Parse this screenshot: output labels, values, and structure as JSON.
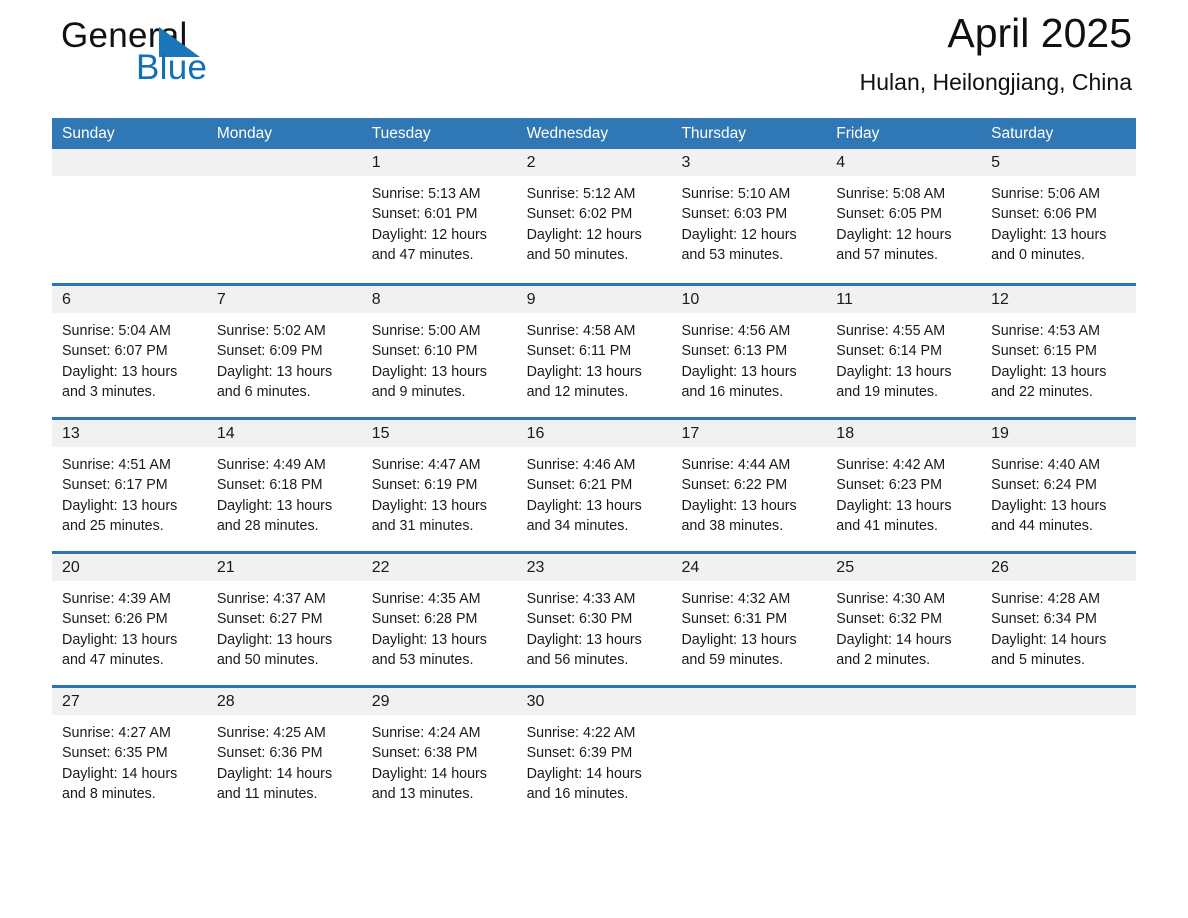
{
  "brand": {
    "word1": "General",
    "word2": "Blue",
    "triangle_color": "#1976b8",
    "blue_text_color": "#1270b8"
  },
  "header": {
    "title": "April 2025",
    "subtitle": "Hulan, Heilongjiang, China"
  },
  "theme": {
    "header_blue": "#3077b5",
    "row_divider_blue": "#2e74b3",
    "day_band_gray": "#f1f1f1"
  },
  "weekdays": [
    "Sunday",
    "Monday",
    "Tuesday",
    "Wednesday",
    "Thursday",
    "Friday",
    "Saturday"
  ],
  "weeks": [
    [
      {
        "day": "",
        "lines": []
      },
      {
        "day": "",
        "lines": []
      },
      {
        "day": "1",
        "lines": [
          "Sunrise: 5:13 AM",
          "Sunset: 6:01 PM",
          "Daylight: 12 hours",
          "and 47 minutes."
        ]
      },
      {
        "day": "2",
        "lines": [
          "Sunrise: 5:12 AM",
          "Sunset: 6:02 PM",
          "Daylight: 12 hours",
          "and 50 minutes."
        ]
      },
      {
        "day": "3",
        "lines": [
          "Sunrise: 5:10 AM",
          "Sunset: 6:03 PM",
          "Daylight: 12 hours",
          "and 53 minutes."
        ]
      },
      {
        "day": "4",
        "lines": [
          "Sunrise: 5:08 AM",
          "Sunset: 6:05 PM",
          "Daylight: 12 hours",
          "and 57 minutes."
        ]
      },
      {
        "day": "5",
        "lines": [
          "Sunrise: 5:06 AM",
          "Sunset: 6:06 PM",
          "Daylight: 13 hours",
          "and 0 minutes."
        ]
      }
    ],
    [
      {
        "day": "6",
        "lines": [
          "Sunrise: 5:04 AM",
          "Sunset: 6:07 PM",
          "Daylight: 13 hours",
          "and 3 minutes."
        ]
      },
      {
        "day": "7",
        "lines": [
          "Sunrise: 5:02 AM",
          "Sunset: 6:09 PM",
          "Daylight: 13 hours",
          "and 6 minutes."
        ]
      },
      {
        "day": "8",
        "lines": [
          "Sunrise: 5:00 AM",
          "Sunset: 6:10 PM",
          "Daylight: 13 hours",
          "and 9 minutes."
        ]
      },
      {
        "day": "9",
        "lines": [
          "Sunrise: 4:58 AM",
          "Sunset: 6:11 PM",
          "Daylight: 13 hours",
          "and 12 minutes."
        ]
      },
      {
        "day": "10",
        "lines": [
          "Sunrise: 4:56 AM",
          "Sunset: 6:13 PM",
          "Daylight: 13 hours",
          "and 16 minutes."
        ]
      },
      {
        "day": "11",
        "lines": [
          "Sunrise: 4:55 AM",
          "Sunset: 6:14 PM",
          "Daylight: 13 hours",
          "and 19 minutes."
        ]
      },
      {
        "day": "12",
        "lines": [
          "Sunrise: 4:53 AM",
          "Sunset: 6:15 PM",
          "Daylight: 13 hours",
          "and 22 minutes."
        ]
      }
    ],
    [
      {
        "day": "13",
        "lines": [
          "Sunrise: 4:51 AM",
          "Sunset: 6:17 PM",
          "Daylight: 13 hours",
          "and 25 minutes."
        ]
      },
      {
        "day": "14",
        "lines": [
          "Sunrise: 4:49 AM",
          "Sunset: 6:18 PM",
          "Daylight: 13 hours",
          "and 28 minutes."
        ]
      },
      {
        "day": "15",
        "lines": [
          "Sunrise: 4:47 AM",
          "Sunset: 6:19 PM",
          "Daylight: 13 hours",
          "and 31 minutes."
        ]
      },
      {
        "day": "16",
        "lines": [
          "Sunrise: 4:46 AM",
          "Sunset: 6:21 PM",
          "Daylight: 13 hours",
          "and 34 minutes."
        ]
      },
      {
        "day": "17",
        "lines": [
          "Sunrise: 4:44 AM",
          "Sunset: 6:22 PM",
          "Daylight: 13 hours",
          "and 38 minutes."
        ]
      },
      {
        "day": "18",
        "lines": [
          "Sunrise: 4:42 AM",
          "Sunset: 6:23 PM",
          "Daylight: 13 hours",
          "and 41 minutes."
        ]
      },
      {
        "day": "19",
        "lines": [
          "Sunrise: 4:40 AM",
          "Sunset: 6:24 PM",
          "Daylight: 13 hours",
          "and 44 minutes."
        ]
      }
    ],
    [
      {
        "day": "20",
        "lines": [
          "Sunrise: 4:39 AM",
          "Sunset: 6:26 PM",
          "Daylight: 13 hours",
          "and 47 minutes."
        ]
      },
      {
        "day": "21",
        "lines": [
          "Sunrise: 4:37 AM",
          "Sunset: 6:27 PM",
          "Daylight: 13 hours",
          "and 50 minutes."
        ]
      },
      {
        "day": "22",
        "lines": [
          "Sunrise: 4:35 AM",
          "Sunset: 6:28 PM",
          "Daylight: 13 hours",
          "and 53 minutes."
        ]
      },
      {
        "day": "23",
        "lines": [
          "Sunrise: 4:33 AM",
          "Sunset: 6:30 PM",
          "Daylight: 13 hours",
          "and 56 minutes."
        ]
      },
      {
        "day": "24",
        "lines": [
          "Sunrise: 4:32 AM",
          "Sunset: 6:31 PM",
          "Daylight: 13 hours",
          "and 59 minutes."
        ]
      },
      {
        "day": "25",
        "lines": [
          "Sunrise: 4:30 AM",
          "Sunset: 6:32 PM",
          "Daylight: 14 hours",
          "and 2 minutes."
        ]
      },
      {
        "day": "26",
        "lines": [
          "Sunrise: 4:28 AM",
          "Sunset: 6:34 PM",
          "Daylight: 14 hours",
          "and 5 minutes."
        ]
      }
    ],
    [
      {
        "day": "27",
        "lines": [
          "Sunrise: 4:27 AM",
          "Sunset: 6:35 PM",
          "Daylight: 14 hours",
          "and 8 minutes."
        ]
      },
      {
        "day": "28",
        "lines": [
          "Sunrise: 4:25 AM",
          "Sunset: 6:36 PM",
          "Daylight: 14 hours",
          "and 11 minutes."
        ]
      },
      {
        "day": "29",
        "lines": [
          "Sunrise: 4:24 AM",
          "Sunset: 6:38 PM",
          "Daylight: 14 hours",
          "and 13 minutes."
        ]
      },
      {
        "day": "30",
        "lines": [
          "Sunrise: 4:22 AM",
          "Sunset: 6:39 PM",
          "Daylight: 14 hours",
          "and 16 minutes."
        ]
      },
      {
        "day": "",
        "lines": []
      },
      {
        "day": "",
        "lines": []
      },
      {
        "day": "",
        "lines": []
      }
    ]
  ]
}
